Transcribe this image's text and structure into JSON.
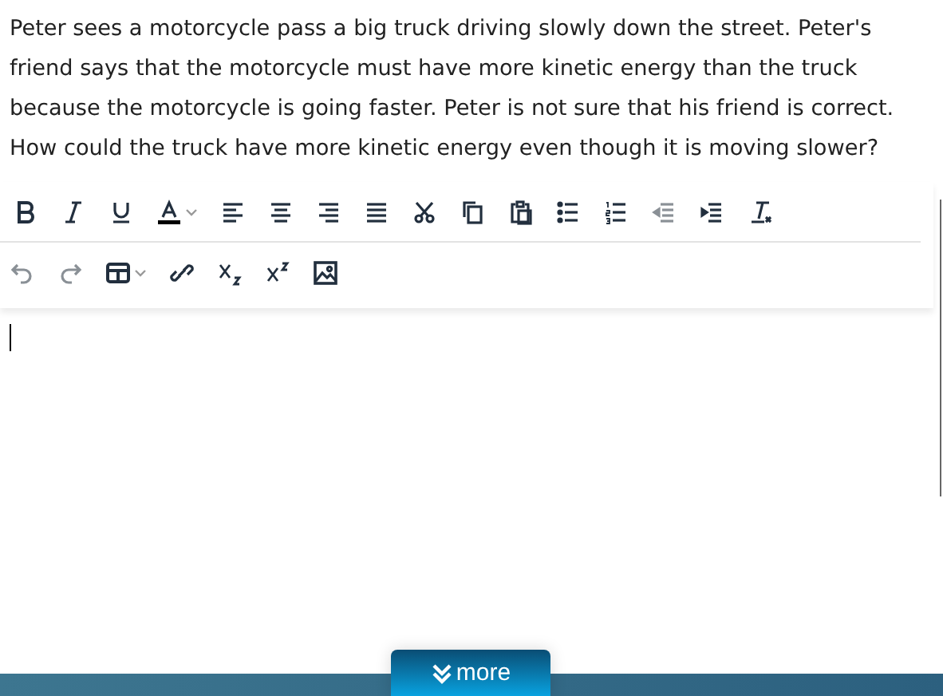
{
  "question": "Peter sees a motorcycle pass a big truck driving slowly down the street. Peter's friend says that the motorcycle must have more kinetic energy than the truck because the motorcycle is going faster. Peter is not sure that his friend is correct. How could the truck have more kinetic energy even though it is moving slower?",
  "toolbar_rows": [
    [
      {
        "kind": "bold",
        "disabled": false
      },
      {
        "kind": "italic",
        "disabled": false
      },
      {
        "kind": "underline",
        "disabled": false
      },
      {
        "kind": "font-color",
        "disabled": false
      },
      {
        "kind": "align-left",
        "disabled": false
      },
      {
        "kind": "align-center",
        "disabled": false
      },
      {
        "kind": "align-right",
        "disabled": false
      },
      {
        "kind": "justify",
        "disabled": false
      },
      {
        "kind": "cut",
        "disabled": false
      },
      {
        "kind": "copy",
        "disabled": false
      },
      {
        "kind": "paste",
        "disabled": false
      },
      {
        "kind": "bullet-list",
        "disabled": false
      },
      {
        "kind": "numbered-list",
        "disabled": false
      },
      {
        "kind": "outdent",
        "disabled": true
      },
      {
        "kind": "indent",
        "disabled": false
      },
      {
        "kind": "clear-format",
        "disabled": false
      }
    ],
    [
      {
        "kind": "undo",
        "disabled": true
      },
      {
        "kind": "redo",
        "disabled": true
      },
      {
        "kind": "table",
        "disabled": false
      },
      {
        "kind": "link",
        "disabled": false
      },
      {
        "kind": "subscript",
        "disabled": false
      },
      {
        "kind": "superscript",
        "disabled": false
      },
      {
        "kind": "image",
        "disabled": false
      }
    ]
  ],
  "more_button": {
    "label": "more"
  }
}
